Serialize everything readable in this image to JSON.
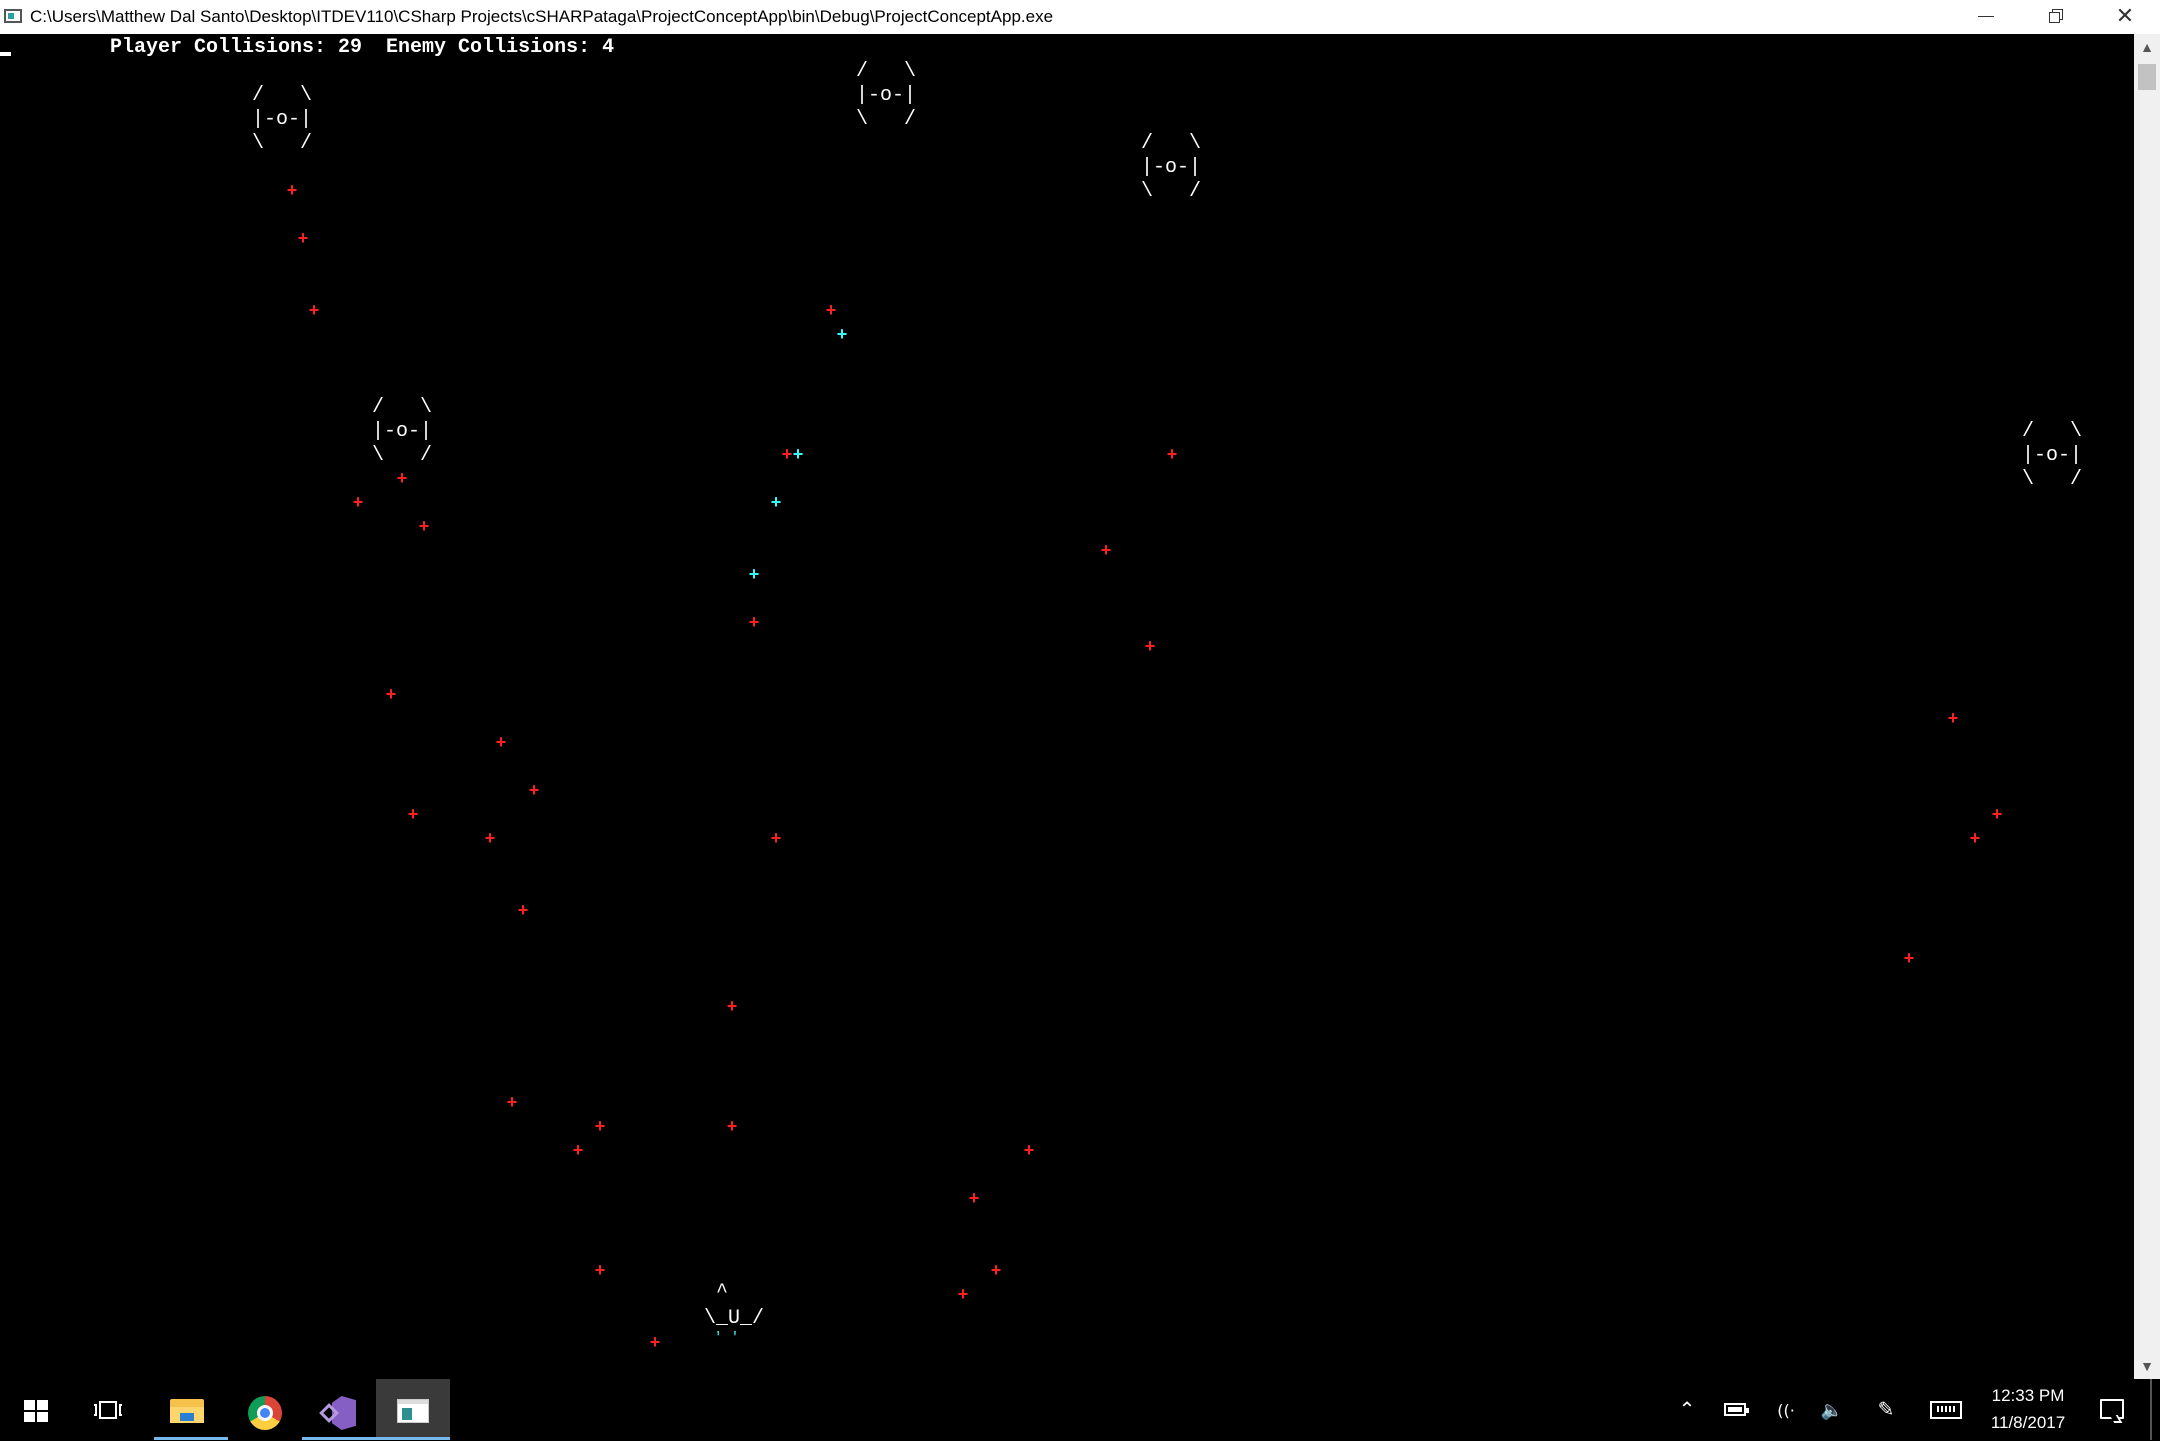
{
  "window": {
    "title": "C:\\Users\\Matthew Dal Santo\\Desktop\\ITDEV110\\CSharp Projects\\cSHARPataga\\ProjectConceptApp\\bin\\Debug\\ProjectConceptApp.exe",
    "minimize_glyph": "–",
    "close_glyph": "✕"
  },
  "hud": {
    "text": "Player Collisions: 29  Enemy Collisions: 4"
  },
  "game": {
    "enemy_sprite": "/   \\\n|-o-|\n\\   /",
    "player_sprite": " ^\n\\_U_/",
    "player_exhaust": "'   '",
    "bullet_glyph": "+",
    "colors": {
      "background": "#000000",
      "enemy_bullet": "#ff2020",
      "player_bullet": "#33ffff",
      "sprite": "#ffffff"
    }
  },
  "scrollbar": {
    "up_glyph": "▲",
    "down_glyph": "▼"
  },
  "taskbar": {
    "pinned": [
      {
        "name": "start",
        "icon": "windows-logo-icon"
      },
      {
        "name": "task-view",
        "icon": "task-view-icon"
      },
      {
        "name": "file-explorer",
        "icon": "folder-icon",
        "active": true
      },
      {
        "name": "chrome",
        "icon": "chrome-icon"
      },
      {
        "name": "visual-studio",
        "icon": "visual-studio-icon",
        "active": true
      },
      {
        "name": "console",
        "icon": "console-icon",
        "active": true,
        "focused": true
      }
    ],
    "tray": {
      "chevron_glyph": "⌃",
      "network_glyph": "((·",
      "volume_glyph": "🔈",
      "pen_glyph": "✎"
    },
    "clock": {
      "time": "12:33 PM",
      "date": "11/8/2017"
    }
  }
}
